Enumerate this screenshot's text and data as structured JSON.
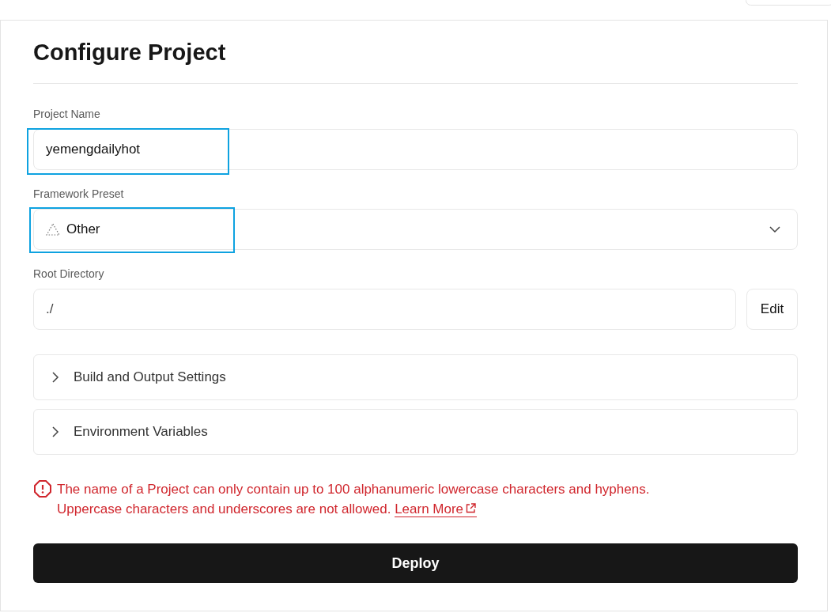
{
  "title": "Configure Project",
  "project_name": {
    "label": "Project Name",
    "value": "yemengdailyhot",
    "highlighted": true
  },
  "framework_preset": {
    "label": "Framework Preset",
    "value": "Other",
    "highlighted": true
  },
  "root_directory": {
    "label": "Root Directory",
    "value": "./",
    "button": "Edit"
  },
  "sections": [
    {
      "label": "Build and Output Settings",
      "expanded": false
    },
    {
      "label": "Environment Variables",
      "expanded": false
    }
  ],
  "error": {
    "message": "The name of a Project can only contain up to 100 alphanumeric lowercase characters and hyphens. Uppercase characters and underscores are not allowed.",
    "link": "Learn More"
  },
  "deploy_button": "Deploy"
}
